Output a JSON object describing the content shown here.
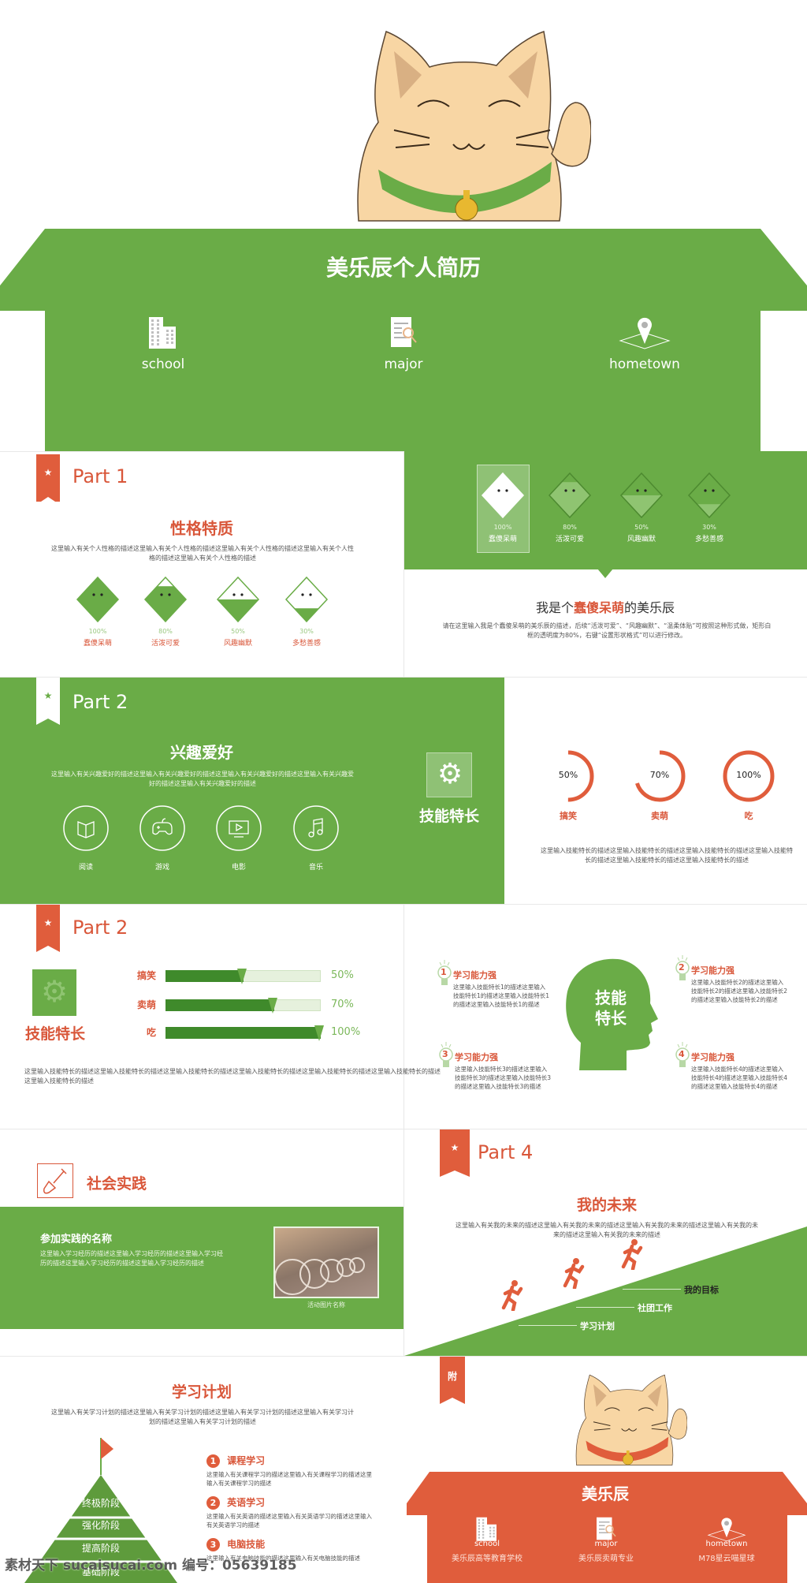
{
  "colors": {
    "green": "#6aac47",
    "orange": "#e05d3c",
    "cat": "#f8d6a4"
  },
  "cover": {
    "title": "美乐辰个人简历",
    "items": [
      {
        "icon": "building-icon",
        "label": "school"
      },
      {
        "icon": "document-search-icon",
        "label": "major"
      },
      {
        "icon": "map-pin-icon",
        "label": "hometown"
      }
    ]
  },
  "personality": {
    "part": "Part 1",
    "title": "性格特质",
    "desc": "这里输入有关个人性格的描述这里输入有关个人性格的描述这里输入有关个人性格的描述这里输入有关个人性格的描述这里输入有关个人性格的描述",
    "traits": [
      {
        "pct": "100%",
        "value": 100,
        "name": "蠢傻呆萌"
      },
      {
        "pct": "80%",
        "value": 80,
        "name": "活泼可爱"
      },
      {
        "pct": "50%",
        "value": 50,
        "name": "风趣幽默"
      },
      {
        "pct": "30%",
        "value": 30,
        "name": "多愁善感"
      }
    ]
  },
  "me": {
    "headline_pre": "我是个",
    "headline_hl": "蠢傻呆萌",
    "headline_post": "的美乐辰",
    "desc": "请在这里输入我是个蠢傻呆萌的美乐辰的描述，后续“活泼可爱”、“风趣幽默”、“温柔体贴”可按照这种形式做，矩形白框的透明度为80%，右键“设置形状格式”可以进行修改。",
    "selected": "蠢傻呆萌"
  },
  "hobbies": {
    "part": "Part 2",
    "title": "兴趣爱好",
    "desc": "这里输入有关兴趣爱好的描述这里输入有关兴趣爱好的描述这里输入有关兴趣爱好的描述这里输入有关兴趣爱好的描述这里输入有关兴趣爱好的描述",
    "items": [
      {
        "icon": "book-icon",
        "label": "阅读"
      },
      {
        "icon": "gamepad-icon",
        "label": "游戏"
      },
      {
        "icon": "tv-icon",
        "label": "电影"
      },
      {
        "icon": "music-note-icon",
        "label": "音乐"
      }
    ]
  },
  "skills_rings": {
    "title": "技能特长",
    "desc": "这里输入技能特长的描述这里输入技能特长的描述这里输入技能特长的描述这里输入技能特长的描述这里输入技能特长的描述这里输入技能特长的描述",
    "items": [
      {
        "pct": "50%",
        "value": 50,
        "label": "搞笑"
      },
      {
        "pct": "70%",
        "value": 70,
        "label": "卖萌"
      },
      {
        "pct": "100%",
        "value": 100,
        "label": "吃"
      }
    ]
  },
  "skills_bars": {
    "part": "Part 2",
    "title": "技能特长",
    "desc": "这里输入技能特长的描述这里输入技能特长的描述这里输入技能特长的描述这里输入技能特长的描述这里输入技能特长的描述这里输入技能特长的描述这里输入技能特长的描述",
    "items": [
      {
        "label": "搞笑",
        "pct": "50%",
        "value": 50
      },
      {
        "label": "卖萌",
        "pct": "70%",
        "value": 70
      },
      {
        "label": "吃",
        "pct": "100%",
        "value": 100
      }
    ]
  },
  "skills_head": {
    "center1": "技能",
    "center2": "特长",
    "items": [
      {
        "num": "1",
        "title": "学习能力强",
        "desc": "这里输入技能特长1的描述这里输入技能特长1的描述这里输入技能特长1的描述这里输入技能特长1的描述"
      },
      {
        "num": "2",
        "title": "学习能力强",
        "desc": "这里输入技能特长2的描述这里输入技能特长2的描述这里输入技能特长2的描述这里输入技能特长2的描述"
      },
      {
        "num": "3",
        "title": "学习能力强",
        "desc": "这里输入技能特长3的描述这里输入技能特长3的描述这里输入技能特长3的描述这里输入技能特长3的描述"
      },
      {
        "num": "4",
        "title": "学习能力强",
        "desc": "这里输入技能特长4的描述这里输入技能特长4的描述这里输入技能特长4的描述这里输入技能特长4的描述"
      }
    ]
  },
  "practice": {
    "title": "社会实践",
    "name": "参加实践的名称",
    "desc": "这里输入学习经历的描述这里输入学习经历的描述这里输入学习经历的描述这里输入学习经历的描述这里输入学习经历的描述",
    "caption": "活动图片名称"
  },
  "future": {
    "part": "Part 4",
    "title": "我的未来",
    "desc": "这里输入有关我的未来的描述这里输入有关我的未来的描述这里输入有关我的未来的描述这里输入有关我的未来的描述这里输入有关我的未来的描述",
    "steps": [
      "学习计划",
      "社团工作",
      "我的目标"
    ]
  },
  "plan": {
    "title": "学习计划",
    "desc": "这里输入有关学习计划的描述这里输入有关学习计划的描述这里输入有关学习计划的描述这里输入有关学习计划的描述这里输入有关学习计划的描述",
    "levels": [
      "终极阶段",
      "强化阶段",
      "提高阶段",
      "基础阶段"
    ],
    "items": [
      {
        "num": "1",
        "title": "课程学习",
        "desc": "这里输入有关课程学习的描述这里输入有关课程学习的描述这里输入有关课程学习的描述"
      },
      {
        "num": "2",
        "title": "英语学习",
        "desc": "这里输入有关英语的描述这里输入有关英语学习的描述这里输入有关英语学习的描述"
      },
      {
        "num": "3",
        "title": "电脑技能",
        "desc": "这里输入有关电脑技能的描述这里输入有关电脑技能的描述"
      }
    ]
  },
  "appendix": {
    "tag": "附",
    "name": "美乐辰",
    "items": [
      {
        "icon": "building-icon",
        "label": "school",
        "value": "美乐辰高等教育学校"
      },
      {
        "icon": "document-search-icon",
        "label": "major",
        "value": "美乐辰卖萌专业"
      },
      {
        "icon": "map-pin-icon",
        "label": "hometown",
        "value": "M78星云喵星球"
      }
    ]
  },
  "watermark": "素材天下 sucaisucai.com  编号：05639185"
}
